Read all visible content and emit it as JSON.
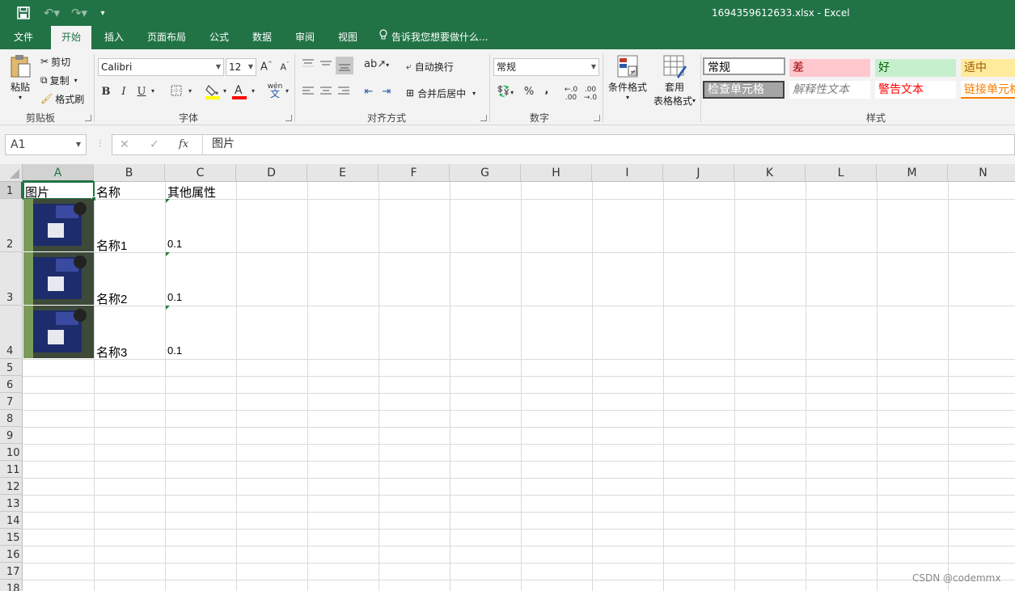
{
  "window": {
    "title": "1694359612633.xlsx - Excel"
  },
  "quick_access": {
    "save_icon": "save-icon",
    "undo_icon": "undo-icon",
    "redo_icon": "redo-icon",
    "more_icon": "customize-icon"
  },
  "tabs": [
    {
      "label": "文件"
    },
    {
      "label": "开始",
      "active": true
    },
    {
      "label": "插入"
    },
    {
      "label": "页面布局"
    },
    {
      "label": "公式"
    },
    {
      "label": "数据"
    },
    {
      "label": "审阅"
    },
    {
      "label": "视图"
    }
  ],
  "tell_me": "告诉我您想要做什么...",
  "clipboard": {
    "paste": "粘贴",
    "cut": "剪切",
    "copy": "复制",
    "format_painter": "格式刷",
    "group": "剪贴板"
  },
  "font": {
    "name": "Calibri",
    "size": "12",
    "bold": "B",
    "italic": "I",
    "underline": "U",
    "group": "字体",
    "phonetic": "wén"
  },
  "alignment": {
    "wrap": "自动换行",
    "merge": "合并后居中",
    "group": "对齐方式"
  },
  "number": {
    "format": "常规",
    "percent": "%",
    "comma": ",",
    "group": "数字"
  },
  "styles_cmds": {
    "conditional": "条件格式",
    "table_top": "套用",
    "table_bottom": "表格格式"
  },
  "styles": {
    "group": "样式",
    "cells": [
      {
        "label": "常规",
        "bg": "#ffffff",
        "color": "#000000"
      },
      {
        "label": "差",
        "bg": "#ffc7ce",
        "color": "#9c0006"
      },
      {
        "label": "好",
        "bg": "#c6efce",
        "color": "#006100"
      },
      {
        "label": "适中",
        "bg": "#ffeb9c",
        "color": "#9c5700"
      },
      {
        "label": "检查单元格",
        "bg": "#a5a5a5",
        "color": "#ffffff"
      },
      {
        "label": "解释性文本",
        "bg": "#ffffff",
        "color": "#7f7f7f"
      },
      {
        "label": "警告文本",
        "bg": "#ffffff",
        "color": "#ff0000"
      },
      {
        "label": "链接单元格",
        "bg": "#ffffff",
        "color": "#fa7d00"
      }
    ]
  },
  "formula_bar": {
    "name_box": "A1",
    "fx": "fx",
    "value": "图片"
  },
  "columns": [
    "A",
    "B",
    "C",
    "D",
    "E",
    "F",
    "G",
    "H",
    "I",
    "J",
    "K",
    "L",
    "M",
    "N"
  ],
  "rows": [
    "1",
    "2",
    "3",
    "4",
    "5",
    "6",
    "7",
    "8",
    "9",
    "10",
    "11",
    "12",
    "13",
    "14",
    "15",
    "16",
    "17",
    "18"
  ],
  "sheet": {
    "header": [
      "图片",
      "名称",
      "其他属性"
    ],
    "data": [
      {
        "name": "名称1",
        "value": "0.1",
        "image": "photo-thumbnail"
      },
      {
        "name": "名称2",
        "value": "0.1",
        "image": "photo-thumbnail"
      },
      {
        "name": "名称3",
        "value": "0.1",
        "image": "photo-thumbnail"
      }
    ]
  },
  "watermark": "CSDN @codemmx"
}
